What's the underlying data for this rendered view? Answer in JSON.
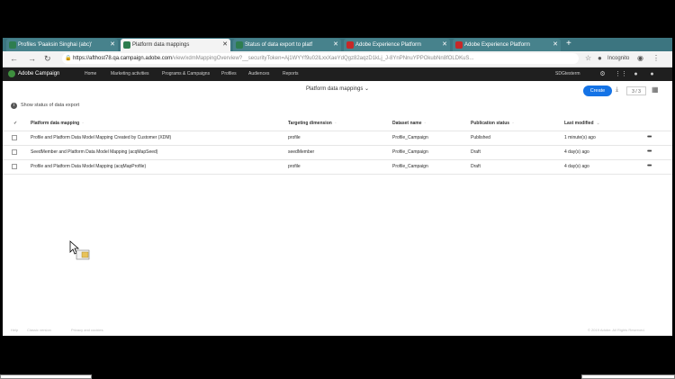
{
  "tabs": [
    {
      "label": "Profiles 'Paaksin Singhai (abc)'",
      "icon_color": "#2e7d4f",
      "active": false
    },
    {
      "label": "Platform data mappings",
      "icon_color": "#2e7d4f",
      "active": true
    },
    {
      "label": "Status of data export to platf",
      "icon_color": "#2e7d4f",
      "active": false
    },
    {
      "label": "Adobe Experience Platform",
      "icon_color": "#c62828",
      "active": false
    },
    {
      "label": "Adobe Experience Platform",
      "icon_color": "#c62828",
      "active": false
    }
  ],
  "url": {
    "host": "https://afthost78.qa.campaign.adobe.com",
    "path": "/view/xdmMappingOverview?__securityToken=Aj1WYYf9u02lLxxXaeYdQgz82aqzD1kLj_J-8YnPNnuYPPOkubNn8fOLDKuS..."
  },
  "browser": {
    "incognito_label": "Incognito"
  },
  "app": {
    "name": "Adobe Campaign",
    "nav": [
      "Home",
      "Marketing activities",
      "Programs & Campaigns",
      "Profiles",
      "Audiences",
      "Reports"
    ],
    "user": "SDGtesterm"
  },
  "page": {
    "title": "Platform data mappings",
    "create_label": "Create",
    "pager": "3 / 3",
    "status_link": "Show status of data export"
  },
  "table": {
    "headers": [
      "Platform data mapping",
      "Targeting dimension",
      "Dataset name",
      "Publication status",
      "Last modified"
    ],
    "rows": [
      [
        "Profile and Platform Data Model Mapping Created by Customer (XDM)",
        "profile",
        "Profile_Campaign",
        "Published",
        "1 minute(s) ago"
      ],
      [
        "SeedMember and Platform Data Model Mapping (acqMapSeed)",
        "seedMember",
        "Profile_Campaign",
        "Draft",
        "4 day(s) ago"
      ],
      [
        "Profile and Platform Data Model Mapping (acqMapProfile)",
        "profile",
        "Profile_Campaign",
        "Draft",
        "4 day(s) ago"
      ]
    ]
  },
  "footer": {
    "links": [
      "Help",
      "Classic version",
      "Privacy and cookies"
    ],
    "copyright": "© 2019 Adobe. All Rights Reserved."
  },
  "colors": {
    "accent": "#1473e6",
    "tabstrip": "#3c7580",
    "appbar": "#1f1f1f"
  }
}
